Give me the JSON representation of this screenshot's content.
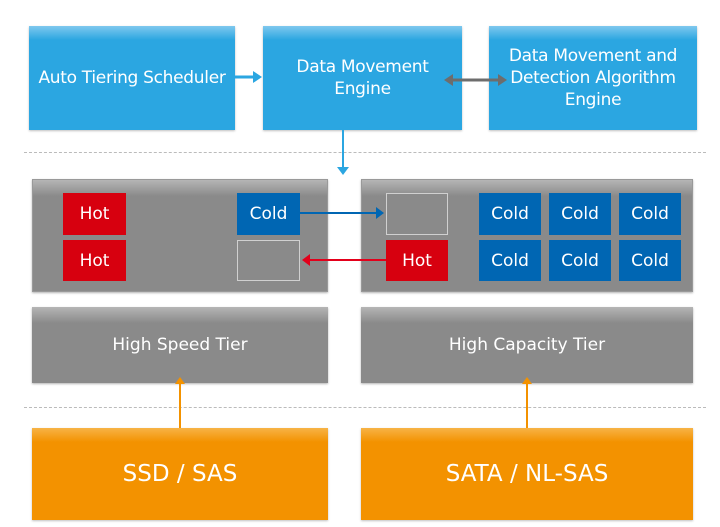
{
  "top": {
    "scheduler": "Auto Tiering Scheduler",
    "engine": "Data Movement Engine",
    "algorithm": "Data Movement and Detection Algorithm Engine"
  },
  "blocks": {
    "hot": "Hot",
    "cold": "Cold"
  },
  "tiers": {
    "speed": "High Speed Tier",
    "capacity": "High Capacity Tier"
  },
  "disks": {
    "ssd": "SSD / SAS",
    "sata": "SATA / NL-SAS"
  },
  "colors": {
    "blue": "#2ba6e1",
    "hot": "#d7000f",
    "cold": "#0066b3",
    "tier": "#8a8a8a",
    "disk": "#f39200"
  }
}
